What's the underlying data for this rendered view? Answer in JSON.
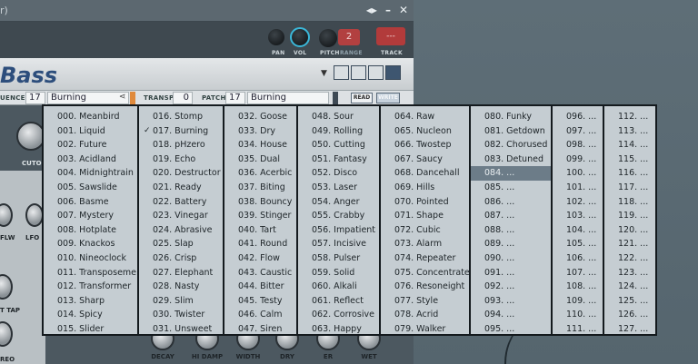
{
  "window": {
    "title": "r)",
    "titlebar_icons": [
      "arrows-icon",
      "minimize-icon",
      "close-icon"
    ]
  },
  "header": {
    "pan_label": "PAN",
    "vol_label": "VOL",
    "pitch_label": "PITCH",
    "range_label": "RANGE",
    "pitch_range_value": "2",
    "track_label": "TRACK",
    "track_value": "---"
  },
  "plugin": {
    "name": "Bass"
  },
  "preset_bar": {
    "sequence_label": "UENCE",
    "sequence_number": "17",
    "sequence_name": "Burning",
    "transp_label": "TRANSP",
    "transp_value": "0",
    "patch_label": "PATCH",
    "patch_number": "17",
    "patch_name": "Burning",
    "read_label": "READ",
    "write_label": "WRITE"
  },
  "body": {
    "cutoff_label": "CUTO",
    "flw_label": "FLW",
    "lfo_label": "LFO",
    "tap_label": "T TAP",
    "stereo_label": "REO"
  },
  "bottom_knobs": [
    "DECAY",
    "HI DAMP",
    "WIDTH",
    "DRY",
    "ER",
    "WET"
  ],
  "menu": {
    "checked_item": "017. Burning",
    "selected_item": "084. ...",
    "columns": [
      [
        "000. Meanbird",
        "001. Liquid",
        "002. Future",
        "003. Acidland",
        "004. Midnightrain",
        "005. Sawslide",
        "006. Basme",
        "007. Mystery",
        "008. Hotplate",
        "009. Knackos",
        "010. Nineoclock",
        "011. Transposeme",
        "012. Transformer",
        "013. Sharp",
        "014. Spicy",
        "015. Slider"
      ],
      [
        "016. Stomp",
        "017. Burning",
        "018. pHzero",
        "019. Echo",
        "020. Destructor",
        "021. Ready",
        "022. Battery",
        "023. Vinegar",
        "024. Abrasive",
        "025. Slap",
        "026. Crisp",
        "027. Elephant",
        "028. Nasty",
        "029. Slim",
        "030. Twister",
        "031. Unsweet"
      ],
      [
        "032. Goose",
        "033. Dry",
        "034. House",
        "035. Dual",
        "036. Acerbic",
        "037. Biting",
        "038. Bouncy",
        "039. Stinger",
        "040. Tart",
        "041. Round",
        "042. Flow",
        "043. Caustic",
        "044. Bitter",
        "045. Testy",
        "046. Calm",
        "047. Siren"
      ],
      [
        "048. Sour",
        "049. Rolling",
        "050. Cutting",
        "051. Fantasy",
        "052. Disco",
        "053. Laser",
        "054. Anger",
        "055. Crabby",
        "056. Impatient",
        "057. Incisive",
        "058. Pulser",
        "059. Solid",
        "060. Alkali",
        "061. Reflect",
        "062. Corrosive",
        "063. Happy"
      ],
      [
        "064. Raw",
        "065. Nucleon",
        "066. Twostep",
        "067. Saucy",
        "068. Dancehall",
        "069. Hills",
        "070. Pointed",
        "071. Shape",
        "072. Cubic",
        "073. Alarm",
        "074. Repeater",
        "075. Concentrate",
        "076. Resoneight",
        "077. Style",
        "078. Acrid",
        "079. Walker"
      ],
      [
        "080. Funky",
        "081. Getdown",
        "082. Chorused",
        "083. Detuned",
        "084. ...",
        "085. ...",
        "086. ...",
        "087. ...",
        "088. ...",
        "089. ...",
        "090. ...",
        "091. ...",
        "092. ...",
        "093. ...",
        "094. ...",
        "095. ..."
      ],
      [
        "096. ...",
        "097. ...",
        "098. ...",
        "099. ...",
        "100. ...",
        "101. ...",
        "102. ...",
        "103. ...",
        "104. ...",
        "105. ...",
        "106. ...",
        "107. ...",
        "108. ...",
        "109. ...",
        "110. ...",
        "111. ..."
      ],
      [
        "112. ...",
        "113. ...",
        "114. ...",
        "115. ...",
        "116. ...",
        "117. ...",
        "118. ...",
        "119. ...",
        "120. ...",
        "121. ...",
        "122. ...",
        "123. ...",
        "124. ...",
        "125. ...",
        "126. ...",
        "127. ..."
      ]
    ]
  },
  "colors": {
    "vol_accent": "#3bb7d8",
    "track_red": "#b23b3b",
    "menu_bg": "#c5cdd2",
    "selection": "#6c7c88"
  }
}
